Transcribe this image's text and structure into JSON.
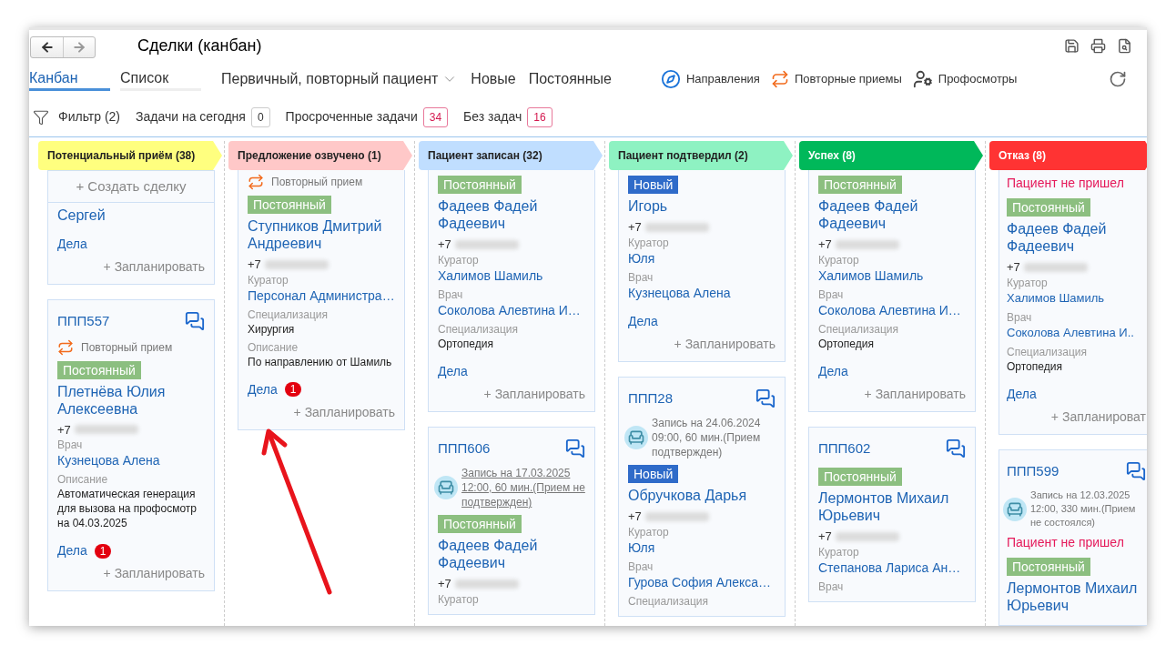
{
  "window": {
    "title": "Сделки (канбан)"
  },
  "view_tabs": [
    {
      "label": "Канбан",
      "selected": true
    },
    {
      "label": "Список",
      "selected": false
    }
  ],
  "segment_filter": {
    "value": "Первичный, повторный пациент"
  },
  "quick_filters": [
    "Новые",
    "Постоянные"
  ],
  "links": [
    {
      "kind": "compass",
      "label": "Направления"
    },
    {
      "kind": "repeat",
      "label": "Повторные приемы"
    },
    {
      "kind": "checkup",
      "label": "Профосмотры"
    }
  ],
  "filter_bar": {
    "filter": "Фильтр (2)",
    "counters": [
      {
        "label": "Задачи на сегодня",
        "count": "0",
        "alert": false
      },
      {
        "label": "Просроченные задачи",
        "count": "34",
        "alert": true
      },
      {
        "label": "Без задач",
        "count": "16",
        "alert": true
      }
    ]
  },
  "columns": [
    {
      "title": "Потенциальный приём (38)",
      "color": "#ffff7f",
      "create": "+ Создать сделку",
      "cards": [
        {
          "name": "Сергей",
          "tasks": "Дела",
          "plan": "+ Запланировать"
        },
        {
          "id": "ППП557",
          "chat": true,
          "repeat": "Повторный прием",
          "tag": {
            "label": "Постоянный",
            "kind": "regular"
          },
          "name": "Плетнёва Юлия Алексеевна",
          "phone": "+7",
          "fields": [
            {
              "label": "Врач",
              "value": "Кузнецова Алена",
              "kind": "link"
            },
            {
              "label": "Описание",
              "value": "Автоматическая генерация для вызова на профосмотр на 04.03.2025",
              "kind": "text"
            }
          ],
          "tasks": "Дела",
          "badge": "1",
          "plan": "+ Запланировать"
        }
      ]
    },
    {
      "title": "Предложение озвучено (1)",
      "color": "#ffc8c8",
      "cards": [
        {
          "repeat": "Повторный прием",
          "tag": {
            "label": "Постоянный",
            "kind": "regular"
          },
          "name": "Ступников Дмитрий Андреевич",
          "phone": "+7",
          "fields": [
            {
              "label": "Куратор",
              "value": "Персонал Администра…",
              "kind": "link"
            },
            {
              "label": "Специализация",
              "value": "Хирургия",
              "kind": "text"
            },
            {
              "label": "Описание",
              "value": "По направлению от Шамиль",
              "kind": "text"
            }
          ],
          "tasks": "Дела",
          "badge": "1",
          "plan": "+ Запланировать"
        }
      ]
    },
    {
      "title": "Пациент записан (32)",
      "color": "#c0deff",
      "cards": [
        {
          "tag": {
            "label": "Постоянный",
            "kind": "regular"
          },
          "name": "Фадеев Фадей Фадеевич",
          "phone": "+7",
          "fields": [
            {
              "label": "Куратор",
              "value": "Халимов Шамиль",
              "kind": "link"
            },
            {
              "label": "Врач",
              "value": "Соколова Алевтина И…",
              "kind": "link"
            },
            {
              "label": "Специализация",
              "value": "Ортопедия",
              "kind": "text"
            }
          ],
          "tasks": "Дела",
          "plan": "+ Запланировать"
        },
        {
          "id": "ППП606",
          "chat": true,
          "appointment": {
            "text": "Запись на 17.03.2025 12:00, 60 мин.(Прием не подтвержден)",
            "underlined": true
          },
          "tag": {
            "label": "Постоянный",
            "kind": "regular"
          },
          "name": "Фадеев Фадей Фадеевич",
          "phone": "+7",
          "fields": [
            {
              "label": "Куратор"
            }
          ]
        }
      ]
    },
    {
      "title": "Пациент подтвердил (2)",
      "color": "#8ef2c2",
      "cards": [
        {
          "tag": {
            "label": "Новый",
            "kind": "new"
          },
          "name": "Игорь",
          "phone": "+7",
          "fields": [
            {
              "label": "Куратор",
              "value": "Юля",
              "kind": "link"
            },
            {
              "label": "Врач",
              "value": "Кузнецова Алена",
              "kind": "link"
            }
          ],
          "tasks": "Дела",
          "plan": "+ Запланировать"
        },
        {
          "id": "ППП28",
          "chat": true,
          "appointment": {
            "text": "Запись на 24.06.2024 09:00, 60 мин.(Прием подтвержден)",
            "underlined": false
          },
          "tag": {
            "label": "Новый",
            "kind": "new"
          },
          "name": "Обручкова Дарья",
          "phone": "+7",
          "fields": [
            {
              "label": "Куратор",
              "value": "Юля",
              "kind": "link"
            },
            {
              "label": "Врач",
              "value": "Гурова София Алекса…",
              "kind": "link"
            },
            {
              "label": "Специализация"
            }
          ]
        }
      ]
    },
    {
      "title": "Успех (8)",
      "color": "#00b85a",
      "cards": [
        {
          "tag": {
            "label": "Постоянный",
            "kind": "regular"
          },
          "name": "Фадеев Фадей Фадеевич",
          "phone": "+7",
          "fields": [
            {
              "label": "Куратор",
              "value": "Халимов Шамиль",
              "kind": "link"
            },
            {
              "label": "Врач",
              "value": "Соколова Алевтина И…",
              "kind": "link"
            },
            {
              "label": "Специализация",
              "value": "Ортопедия",
              "kind": "text"
            }
          ],
          "tasks": "Дела",
          "plan": "+ Запланировать"
        },
        {
          "id": "ППП602",
          "chat": true,
          "tag": {
            "label": "Постоянный",
            "kind": "regular"
          },
          "name": "Лермонтов Михаил Юрьевич",
          "phone": "+7",
          "fields": [
            {
              "label": "Куратор",
              "value": "Степанова Лариса Ан…",
              "kind": "link"
            },
            {
              "label": "Врач"
            }
          ]
        }
      ]
    },
    {
      "title": "Отказ (8)",
      "color": "#ff3333",
      "cards": [
        {
          "status": "Пациент не пришел",
          "tag": {
            "label": "Постоянный",
            "kind": "regular"
          },
          "name": "Фадеев Фадей Фадеевич",
          "phone": "+7",
          "fields": [
            {
              "label": "Куратор",
              "value": "Халимов Шамиль",
              "kind": "link"
            },
            {
              "label": "Врач",
              "value": "Соколова Алевтина И..",
              "kind": "link"
            },
            {
              "label": "Специализация",
              "value": "Ортопедия",
              "kind": "text"
            }
          ],
          "tasks": "Дела",
          "plan": "+ Запланироват"
        },
        {
          "id": "ППП599",
          "chat": true,
          "appointment": {
            "text": "Запись на 12.03.2025 12:00, 330 мин.(Прием не состоялся)",
            "underlined": false
          },
          "status": "Пациент не пришел",
          "tag": {
            "label": "Постоянный",
            "kind": "regular"
          },
          "name": "Лермонтов Михаил Юрьевич"
        }
      ]
    }
  ]
}
